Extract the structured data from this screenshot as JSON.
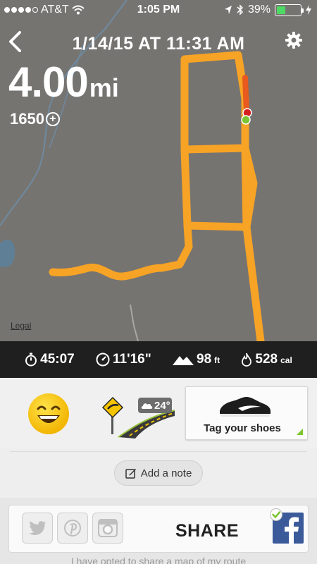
{
  "status_bar": {
    "carrier": "AT&T",
    "time": "1:05 PM",
    "battery_percent": "39%",
    "battery_level": 0.39,
    "icons": [
      "wifi-icon",
      "location-arrow-icon",
      "bluetooth-icon",
      "charging-bolt-icon"
    ]
  },
  "header": {
    "date_time": "1/14/15 AT 11:31 AM"
  },
  "run": {
    "distance_value": "4.00",
    "distance_unit": "mi",
    "fuel": "1650"
  },
  "map": {
    "legal_label": "Legal",
    "route_color": "#f7a325",
    "background_color": "#767471"
  },
  "stats": {
    "duration": "45:07",
    "pace": "11'16\"",
    "elevation_value": "98",
    "elevation_unit": "ft",
    "calories_value": "528",
    "calories_unit": "cal"
  },
  "activity": {
    "mood_icon": "happy-face-icon",
    "terrain_icon": "road-terrain-icon",
    "temperature": "24°",
    "weather_icon": "cloud-icon",
    "tag_shoes_label": "Tag your shoes",
    "accent_color": "#7cc432"
  },
  "note": {
    "label": "Add a note"
  },
  "share": {
    "label": "SHARE",
    "footer_text": "I have opted to share a map of my route",
    "networks": [
      "twitter",
      "pinterest",
      "instagram",
      "facebook"
    ],
    "facebook_color": "#3b5a9a"
  }
}
